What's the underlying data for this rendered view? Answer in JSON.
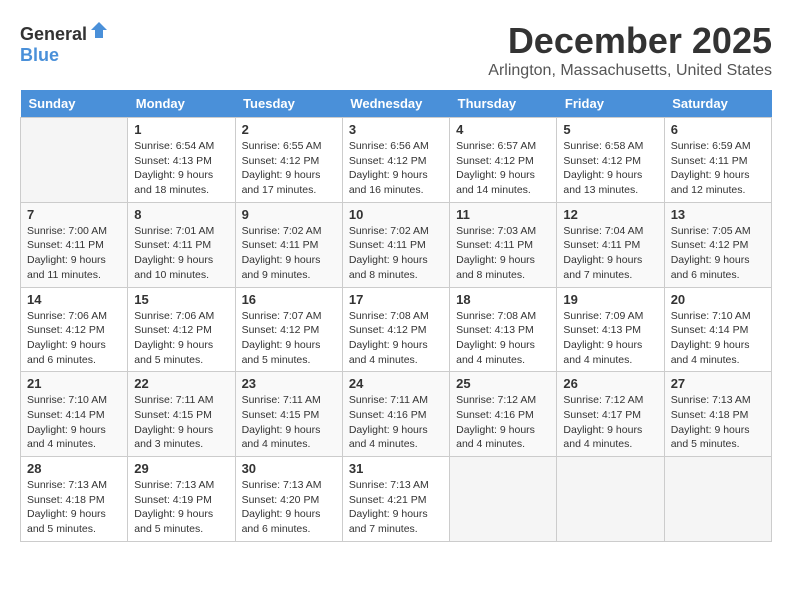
{
  "header": {
    "logo_general": "General",
    "logo_blue": "Blue",
    "month": "December 2025",
    "location": "Arlington, Massachusetts, United States"
  },
  "weekdays": [
    "Sunday",
    "Monday",
    "Tuesday",
    "Wednesday",
    "Thursday",
    "Friday",
    "Saturday"
  ],
  "weeks": [
    [
      {
        "day": "",
        "sunrise": "",
        "sunset": "",
        "daylight": ""
      },
      {
        "day": "1",
        "sunrise": "Sunrise: 6:54 AM",
        "sunset": "Sunset: 4:13 PM",
        "daylight": "Daylight: 9 hours and 18 minutes."
      },
      {
        "day": "2",
        "sunrise": "Sunrise: 6:55 AM",
        "sunset": "Sunset: 4:12 PM",
        "daylight": "Daylight: 9 hours and 17 minutes."
      },
      {
        "day": "3",
        "sunrise": "Sunrise: 6:56 AM",
        "sunset": "Sunset: 4:12 PM",
        "daylight": "Daylight: 9 hours and 16 minutes."
      },
      {
        "day": "4",
        "sunrise": "Sunrise: 6:57 AM",
        "sunset": "Sunset: 4:12 PM",
        "daylight": "Daylight: 9 hours and 14 minutes."
      },
      {
        "day": "5",
        "sunrise": "Sunrise: 6:58 AM",
        "sunset": "Sunset: 4:12 PM",
        "daylight": "Daylight: 9 hours and 13 minutes."
      },
      {
        "day": "6",
        "sunrise": "Sunrise: 6:59 AM",
        "sunset": "Sunset: 4:11 PM",
        "daylight": "Daylight: 9 hours and 12 minutes."
      }
    ],
    [
      {
        "day": "7",
        "sunrise": "Sunrise: 7:00 AM",
        "sunset": "Sunset: 4:11 PM",
        "daylight": "Daylight: 9 hours and 11 minutes."
      },
      {
        "day": "8",
        "sunrise": "Sunrise: 7:01 AM",
        "sunset": "Sunset: 4:11 PM",
        "daylight": "Daylight: 9 hours and 10 minutes."
      },
      {
        "day": "9",
        "sunrise": "Sunrise: 7:02 AM",
        "sunset": "Sunset: 4:11 PM",
        "daylight": "Daylight: 9 hours and 9 minutes."
      },
      {
        "day": "10",
        "sunrise": "Sunrise: 7:02 AM",
        "sunset": "Sunset: 4:11 PM",
        "daylight": "Daylight: 9 hours and 8 minutes."
      },
      {
        "day": "11",
        "sunrise": "Sunrise: 7:03 AM",
        "sunset": "Sunset: 4:11 PM",
        "daylight": "Daylight: 9 hours and 8 minutes."
      },
      {
        "day": "12",
        "sunrise": "Sunrise: 7:04 AM",
        "sunset": "Sunset: 4:11 PM",
        "daylight": "Daylight: 9 hours and 7 minutes."
      },
      {
        "day": "13",
        "sunrise": "Sunrise: 7:05 AM",
        "sunset": "Sunset: 4:12 PM",
        "daylight": "Daylight: 9 hours and 6 minutes."
      }
    ],
    [
      {
        "day": "14",
        "sunrise": "Sunrise: 7:06 AM",
        "sunset": "Sunset: 4:12 PM",
        "daylight": "Daylight: 9 hours and 6 minutes."
      },
      {
        "day": "15",
        "sunrise": "Sunrise: 7:06 AM",
        "sunset": "Sunset: 4:12 PM",
        "daylight": "Daylight: 9 hours and 5 minutes."
      },
      {
        "day": "16",
        "sunrise": "Sunrise: 7:07 AM",
        "sunset": "Sunset: 4:12 PM",
        "daylight": "Daylight: 9 hours and 5 minutes."
      },
      {
        "day": "17",
        "sunrise": "Sunrise: 7:08 AM",
        "sunset": "Sunset: 4:12 PM",
        "daylight": "Daylight: 9 hours and 4 minutes."
      },
      {
        "day": "18",
        "sunrise": "Sunrise: 7:08 AM",
        "sunset": "Sunset: 4:13 PM",
        "daylight": "Daylight: 9 hours and 4 minutes."
      },
      {
        "day": "19",
        "sunrise": "Sunrise: 7:09 AM",
        "sunset": "Sunset: 4:13 PM",
        "daylight": "Daylight: 9 hours and 4 minutes."
      },
      {
        "day": "20",
        "sunrise": "Sunrise: 7:10 AM",
        "sunset": "Sunset: 4:14 PM",
        "daylight": "Daylight: 9 hours and 4 minutes."
      }
    ],
    [
      {
        "day": "21",
        "sunrise": "Sunrise: 7:10 AM",
        "sunset": "Sunset: 4:14 PM",
        "daylight": "Daylight: 9 hours and 4 minutes."
      },
      {
        "day": "22",
        "sunrise": "Sunrise: 7:11 AM",
        "sunset": "Sunset: 4:15 PM",
        "daylight": "Daylight: 9 hours and 3 minutes."
      },
      {
        "day": "23",
        "sunrise": "Sunrise: 7:11 AM",
        "sunset": "Sunset: 4:15 PM",
        "daylight": "Daylight: 9 hours and 4 minutes."
      },
      {
        "day": "24",
        "sunrise": "Sunrise: 7:11 AM",
        "sunset": "Sunset: 4:16 PM",
        "daylight": "Daylight: 9 hours and 4 minutes."
      },
      {
        "day": "25",
        "sunrise": "Sunrise: 7:12 AM",
        "sunset": "Sunset: 4:16 PM",
        "daylight": "Daylight: 9 hours and 4 minutes."
      },
      {
        "day": "26",
        "sunrise": "Sunrise: 7:12 AM",
        "sunset": "Sunset: 4:17 PM",
        "daylight": "Daylight: 9 hours and 4 minutes."
      },
      {
        "day": "27",
        "sunrise": "Sunrise: 7:13 AM",
        "sunset": "Sunset: 4:18 PM",
        "daylight": "Daylight: 9 hours and 5 minutes."
      }
    ],
    [
      {
        "day": "28",
        "sunrise": "Sunrise: 7:13 AM",
        "sunset": "Sunset: 4:18 PM",
        "daylight": "Daylight: 9 hours and 5 minutes."
      },
      {
        "day": "29",
        "sunrise": "Sunrise: 7:13 AM",
        "sunset": "Sunset: 4:19 PM",
        "daylight": "Daylight: 9 hours and 5 minutes."
      },
      {
        "day": "30",
        "sunrise": "Sunrise: 7:13 AM",
        "sunset": "Sunset: 4:20 PM",
        "daylight": "Daylight: 9 hours and 6 minutes."
      },
      {
        "day": "31",
        "sunrise": "Sunrise: 7:13 AM",
        "sunset": "Sunset: 4:21 PM",
        "daylight": "Daylight: 9 hours and 7 minutes."
      },
      {
        "day": "",
        "sunrise": "",
        "sunset": "",
        "daylight": ""
      },
      {
        "day": "",
        "sunrise": "",
        "sunset": "",
        "daylight": ""
      },
      {
        "day": "",
        "sunrise": "",
        "sunset": "",
        "daylight": ""
      }
    ]
  ]
}
